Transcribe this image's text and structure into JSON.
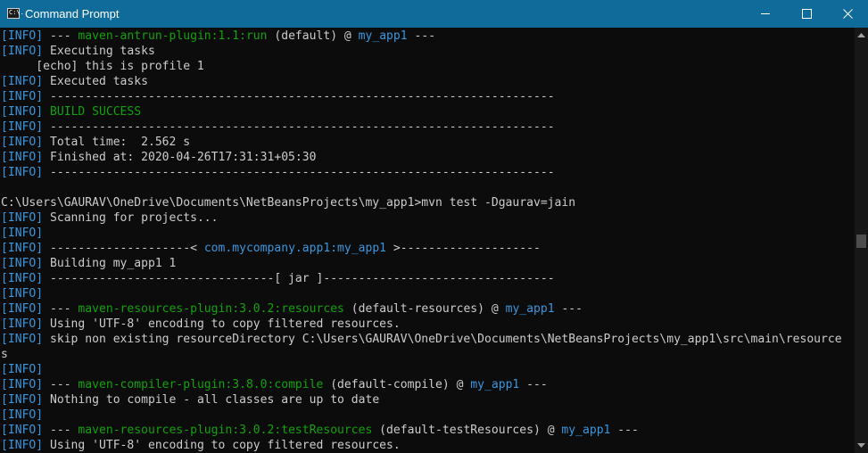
{
  "window": {
    "title": "Command Prompt",
    "icon": "cmd-icon",
    "icon_text": "C:\\."
  },
  "controls": {
    "minimize": "minimize-icon",
    "maximize": "maximize-icon",
    "close": "close-icon"
  },
  "colors": {
    "titlebar": "#0f6b99",
    "background": "#0c0c0c",
    "text": "#cccccc",
    "info_tag": "#3a96dd",
    "plugin_green": "#13a10e",
    "artifact_blue": "#3a96dd"
  },
  "lines": [
    [
      [
        "[INFO]",
        "lvl"
      ],
      [
        " --- ",
        ""
      ],
      [
        "maven-antrun-plugin:1.1:run",
        "g"
      ],
      [
        " (default) @ ",
        ""
      ],
      [
        "my_app1",
        "b"
      ],
      [
        " ---",
        ""
      ]
    ],
    [
      [
        "[INFO]",
        "lvl"
      ],
      [
        " Executing tasks",
        ""
      ]
    ],
    [
      [
        "     [echo] this is profile 1",
        ""
      ]
    ],
    [
      [
        "[INFO]",
        "lvl"
      ],
      [
        " Executed tasks",
        ""
      ]
    ],
    [
      [
        "[INFO]",
        "lvl"
      ],
      [
        " ------------------------------------------------------------------------",
        ""
      ]
    ],
    [
      [
        "[INFO]",
        "lvl"
      ],
      [
        " ",
        ""
      ],
      [
        "BUILD SUCCESS",
        "g"
      ]
    ],
    [
      [
        "[INFO]",
        "lvl"
      ],
      [
        " ------------------------------------------------------------------------",
        ""
      ]
    ],
    [
      [
        "[INFO]",
        "lvl"
      ],
      [
        " Total time:  2.562 s",
        ""
      ]
    ],
    [
      [
        "[INFO]",
        "lvl"
      ],
      [
        " Finished at: 2020-04-26T17:31:31+05:30",
        ""
      ]
    ],
    [
      [
        "[INFO]",
        "lvl"
      ],
      [
        " ------------------------------------------------------------------------",
        ""
      ]
    ],
    [],
    [
      [
        "C:\\Users\\GAURAV\\OneDrive\\Documents\\NetBeansProjects\\my_app1>mvn test -Dgaurav=jain",
        ""
      ]
    ],
    [
      [
        "[INFO]",
        "lvl"
      ],
      [
        " Scanning for projects...",
        ""
      ]
    ],
    [
      [
        "[INFO]",
        "lvl"
      ]
    ],
    [
      [
        "[INFO]",
        "lvl"
      ],
      [
        " --------------------< ",
        ""
      ],
      [
        "com.mycompany.app1:my_app1",
        "b"
      ],
      [
        " >--------------------",
        ""
      ]
    ],
    [
      [
        "[INFO]",
        "lvl"
      ],
      [
        " Building my_app1 1",
        ""
      ]
    ],
    [
      [
        "[INFO]",
        "lvl"
      ],
      [
        " --------------------------------[ jar ]---------------------------------",
        ""
      ]
    ],
    [
      [
        "[INFO]",
        "lvl"
      ]
    ],
    [
      [
        "[INFO]",
        "lvl"
      ],
      [
        " --- ",
        ""
      ],
      [
        "maven-resources-plugin:3.0.2:resources",
        "g"
      ],
      [
        " (default-resources) @ ",
        ""
      ],
      [
        "my_app1",
        "b"
      ],
      [
        " ---",
        ""
      ]
    ],
    [
      [
        "[INFO]",
        "lvl"
      ],
      [
        " Using 'UTF-8' encoding to copy filtered resources.",
        ""
      ]
    ],
    [
      [
        "[INFO]",
        "lvl"
      ],
      [
        " skip non existing resourceDirectory C:\\Users\\GAURAV\\OneDrive\\Documents\\NetBeansProjects\\my_app1\\src\\main\\resource",
        ""
      ]
    ],
    [
      [
        "s",
        ""
      ]
    ],
    [
      [
        "[INFO]",
        "lvl"
      ]
    ],
    [
      [
        "[INFO]",
        "lvl"
      ],
      [
        " --- ",
        ""
      ],
      [
        "maven-compiler-plugin:3.8.0:compile",
        "g"
      ],
      [
        " (default-compile) @ ",
        ""
      ],
      [
        "my_app1",
        "b"
      ],
      [
        " ---",
        ""
      ]
    ],
    [
      [
        "[INFO]",
        "lvl"
      ],
      [
        " Nothing to compile - all classes are up to date",
        ""
      ]
    ],
    [
      [
        "[INFO]",
        "lvl"
      ]
    ],
    [
      [
        "[INFO]",
        "lvl"
      ],
      [
        " --- ",
        ""
      ],
      [
        "maven-resources-plugin:3.0.2:testResources",
        "g"
      ],
      [
        " (default-testResources) @ ",
        ""
      ],
      [
        "my_app1",
        "b"
      ],
      [
        " ---",
        ""
      ]
    ],
    [
      [
        "[INFO]",
        "lvl"
      ],
      [
        " Using 'UTF-8' encoding to copy filtered resources.",
        ""
      ]
    ]
  ],
  "scrollbar": {
    "up_icon": "scroll-up-arrow-icon",
    "down_icon": "scroll-down-arrow-icon"
  }
}
